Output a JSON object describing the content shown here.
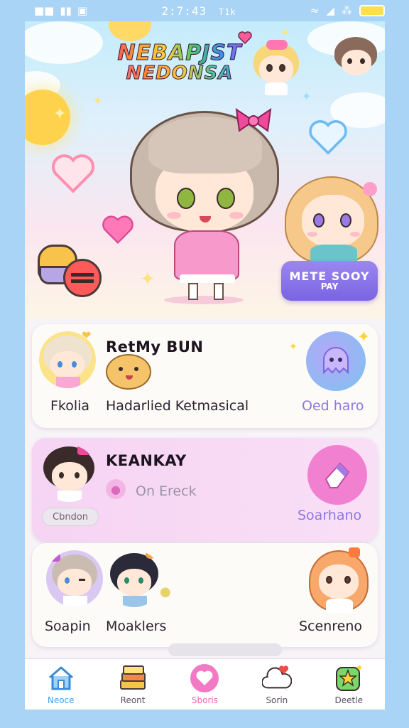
{
  "status_bar": {
    "time": "2:7:43",
    "extra": "T1k"
  },
  "hero": {
    "logo_line1": "NEBAPJST",
    "logo_line2": "NEDONSA",
    "cta": {
      "line1": "METE SOOY",
      "line2": "PAY"
    }
  },
  "cards": [
    {
      "title": "RetMy BUN",
      "label_left": "Fkolia",
      "label_mid": "Hadarlied Ketmasical",
      "link": "Oed haro"
    },
    {
      "title": "KEANKAY",
      "subtitle": "On Ereck",
      "pill": "Cbndon",
      "link": "Soarhano"
    },
    {
      "label_left": "Soapin",
      "label_mid": "Moaklers",
      "link": "Scenreno"
    }
  ],
  "bottom_nav": [
    {
      "label": "Neoce",
      "icon": "home-icon"
    },
    {
      "label": "Reont",
      "icon": "book-stack-icon"
    },
    {
      "label": "Sboris",
      "icon": "heart-icon"
    },
    {
      "label": "Sorin",
      "icon": "cloud-heart-icon"
    },
    {
      "label": "Deetle",
      "icon": "star-badge-icon"
    }
  ],
  "colors": {
    "background": "#a9d4f5",
    "accent_purple": "#8b78e6",
    "accent_pink": "#ec6ab2",
    "accent_blue": "#4aa3e8"
  }
}
